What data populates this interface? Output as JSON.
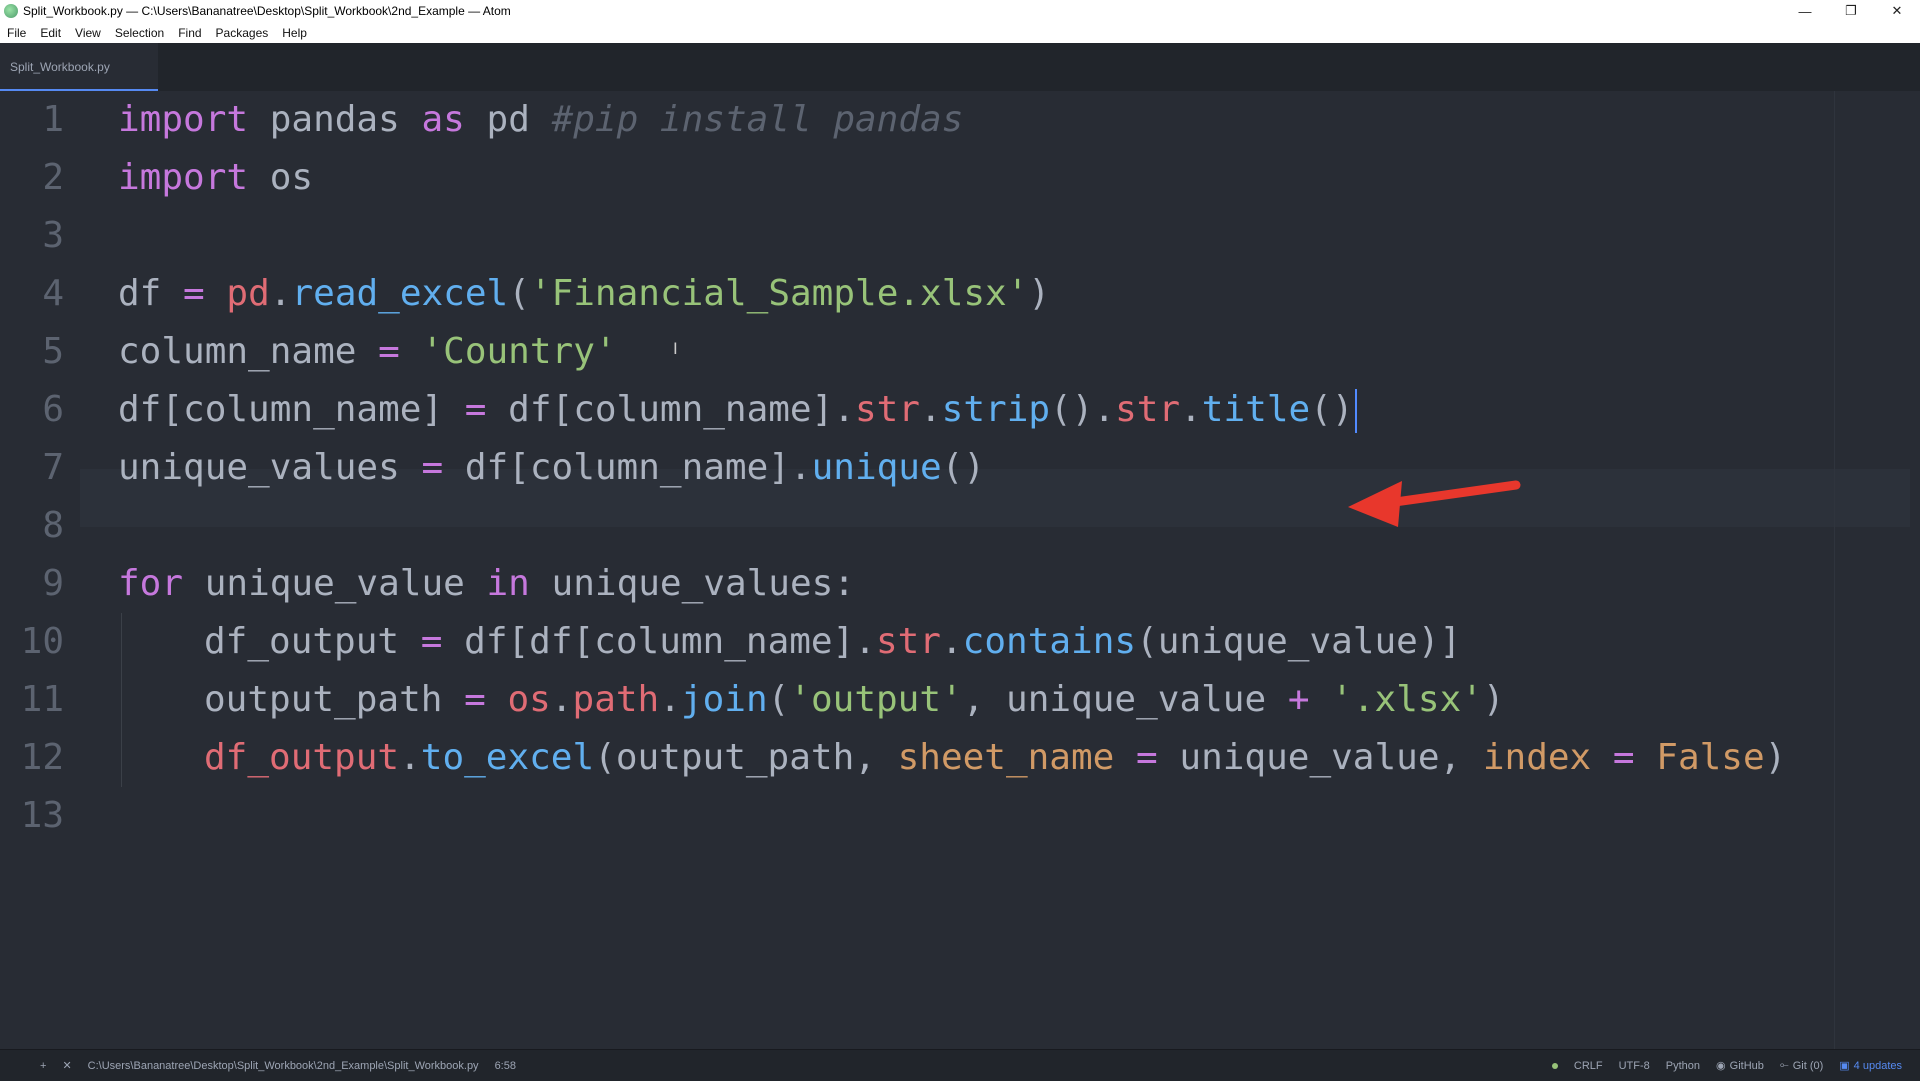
{
  "window": {
    "title": "Split_Workbook.py — C:\\Users\\Bananatree\\Desktop\\Split_Workbook\\2nd_Example — Atom",
    "controls": [
      "—",
      "❐",
      "✕"
    ]
  },
  "menu": [
    "File",
    "Edit",
    "View",
    "Selection",
    "Find",
    "Packages",
    "Help"
  ],
  "tabs": [
    {
      "label": "Split_Workbook.py",
      "active": true
    }
  ],
  "editor": {
    "line_numbers": [
      "1",
      "2",
      "3",
      "4",
      "5",
      "6",
      "7",
      "8",
      "9",
      "10",
      "11",
      "12",
      "13"
    ],
    "cursor_line": 6,
    "lines": [
      {
        "n": 1,
        "tokens": [
          [
            "kw",
            "import"
          ],
          [
            "",
            "pandas"
          ],
          [
            "kw",
            "as"
          ],
          [
            "",
            "pd"
          ],
          [
            "cm",
            "#pip install pandas"
          ]
        ]
      },
      {
        "n": 2,
        "tokens": [
          [
            "kw",
            "import"
          ],
          [
            "",
            "os"
          ]
        ]
      },
      {
        "n": 3,
        "tokens": []
      },
      {
        "n": 4,
        "tokens": [
          [
            "",
            "df"
          ],
          [
            "kw",
            "="
          ],
          [
            "var",
            "pd"
          ],
          [
            "",
            "."
          ],
          [
            "fn",
            "read_excel"
          ],
          [
            "",
            "("
          ],
          [
            "str",
            "'Financial_Sample.xlsx'"
          ],
          [
            "",
            ")"
          ]
        ]
      },
      {
        "n": 5,
        "tokens": [
          [
            "",
            "column_name"
          ],
          [
            "kw",
            "="
          ],
          [
            "str",
            "'Country'"
          ]
        ]
      },
      {
        "n": 6,
        "tokens": [
          [
            "",
            "df[column_name]"
          ],
          [
            "kw",
            "="
          ],
          [
            "",
            "df[column_name]."
          ],
          [
            "var",
            "str"
          ],
          [
            "",
            "."
          ],
          [
            "fn",
            "strip"
          ],
          [
            "",
            "()."
          ],
          [
            "var",
            "str"
          ],
          [
            "",
            "."
          ],
          [
            "fn",
            "title"
          ],
          [
            "",
            "()"
          ]
        ]
      },
      {
        "n": 7,
        "tokens": [
          [
            "",
            "unique_values"
          ],
          [
            "kw",
            "="
          ],
          [
            "",
            "df[column_name]."
          ],
          [
            "fn",
            "unique"
          ],
          [
            "",
            "()"
          ]
        ]
      },
      {
        "n": 8,
        "tokens": []
      },
      {
        "n": 9,
        "tokens": [
          [
            "kw",
            "for"
          ],
          [
            "",
            "unique_value"
          ],
          [
            "kw",
            "in"
          ],
          [
            "",
            "unique_values:"
          ]
        ]
      },
      {
        "n": 10,
        "tokens": [
          [
            "",
            "df_output"
          ],
          [
            "kw",
            "="
          ],
          [
            "",
            "df[df[column_name]."
          ],
          [
            "var",
            "str"
          ],
          [
            "",
            "."
          ],
          [
            "fn",
            "contains"
          ],
          [
            "",
            "(unique_value)]"
          ]
        ]
      },
      {
        "n": 11,
        "tokens": [
          [
            "",
            "output_path"
          ],
          [
            "kw",
            "="
          ],
          [
            "var",
            "os"
          ],
          [
            "",
            "."
          ],
          [
            "var",
            "path"
          ],
          [
            "",
            "."
          ],
          [
            "fn",
            "join"
          ],
          [
            "",
            "("
          ],
          [
            "str",
            "'output'"
          ],
          [
            "",
            ", unique_value"
          ],
          [
            "kw",
            "+"
          ],
          [
            "str",
            "'.xlsx'"
          ],
          [
            "",
            ")"
          ]
        ]
      },
      {
        "n": 12,
        "tokens": [
          [
            "var",
            "df_output"
          ],
          [
            "",
            "."
          ],
          [
            "fn",
            "to_excel"
          ],
          [
            "",
            "(output_path, "
          ],
          [
            "param",
            "sheet_name"
          ],
          [
            "kw",
            "="
          ],
          [
            "",
            "unique_value, "
          ],
          [
            "param",
            "index"
          ],
          [
            "kw",
            "="
          ],
          [
            "param",
            "False"
          ],
          [
            "",
            ")"
          ]
        ]
      },
      {
        "n": 13,
        "tokens": []
      }
    ]
  },
  "statusbar": {
    "file_path": "C:\\Users\\Bananatree\\Desktop\\Split_Workbook\\2nd_Example\\Split_Workbook.py",
    "cursor_pos": "6:58",
    "line_ending": "CRLF",
    "encoding": "UTF-8",
    "grammar": "Python",
    "github": "GitHub",
    "git": "Git (0)",
    "updates": "4 updates"
  },
  "colors": {
    "keyword": "#c678dd",
    "function": "#61afef",
    "string": "#98c379",
    "variable": "#e06c75",
    "parameter": "#d19a66",
    "comment": "#5c6370",
    "arrow": "#e8372c"
  }
}
